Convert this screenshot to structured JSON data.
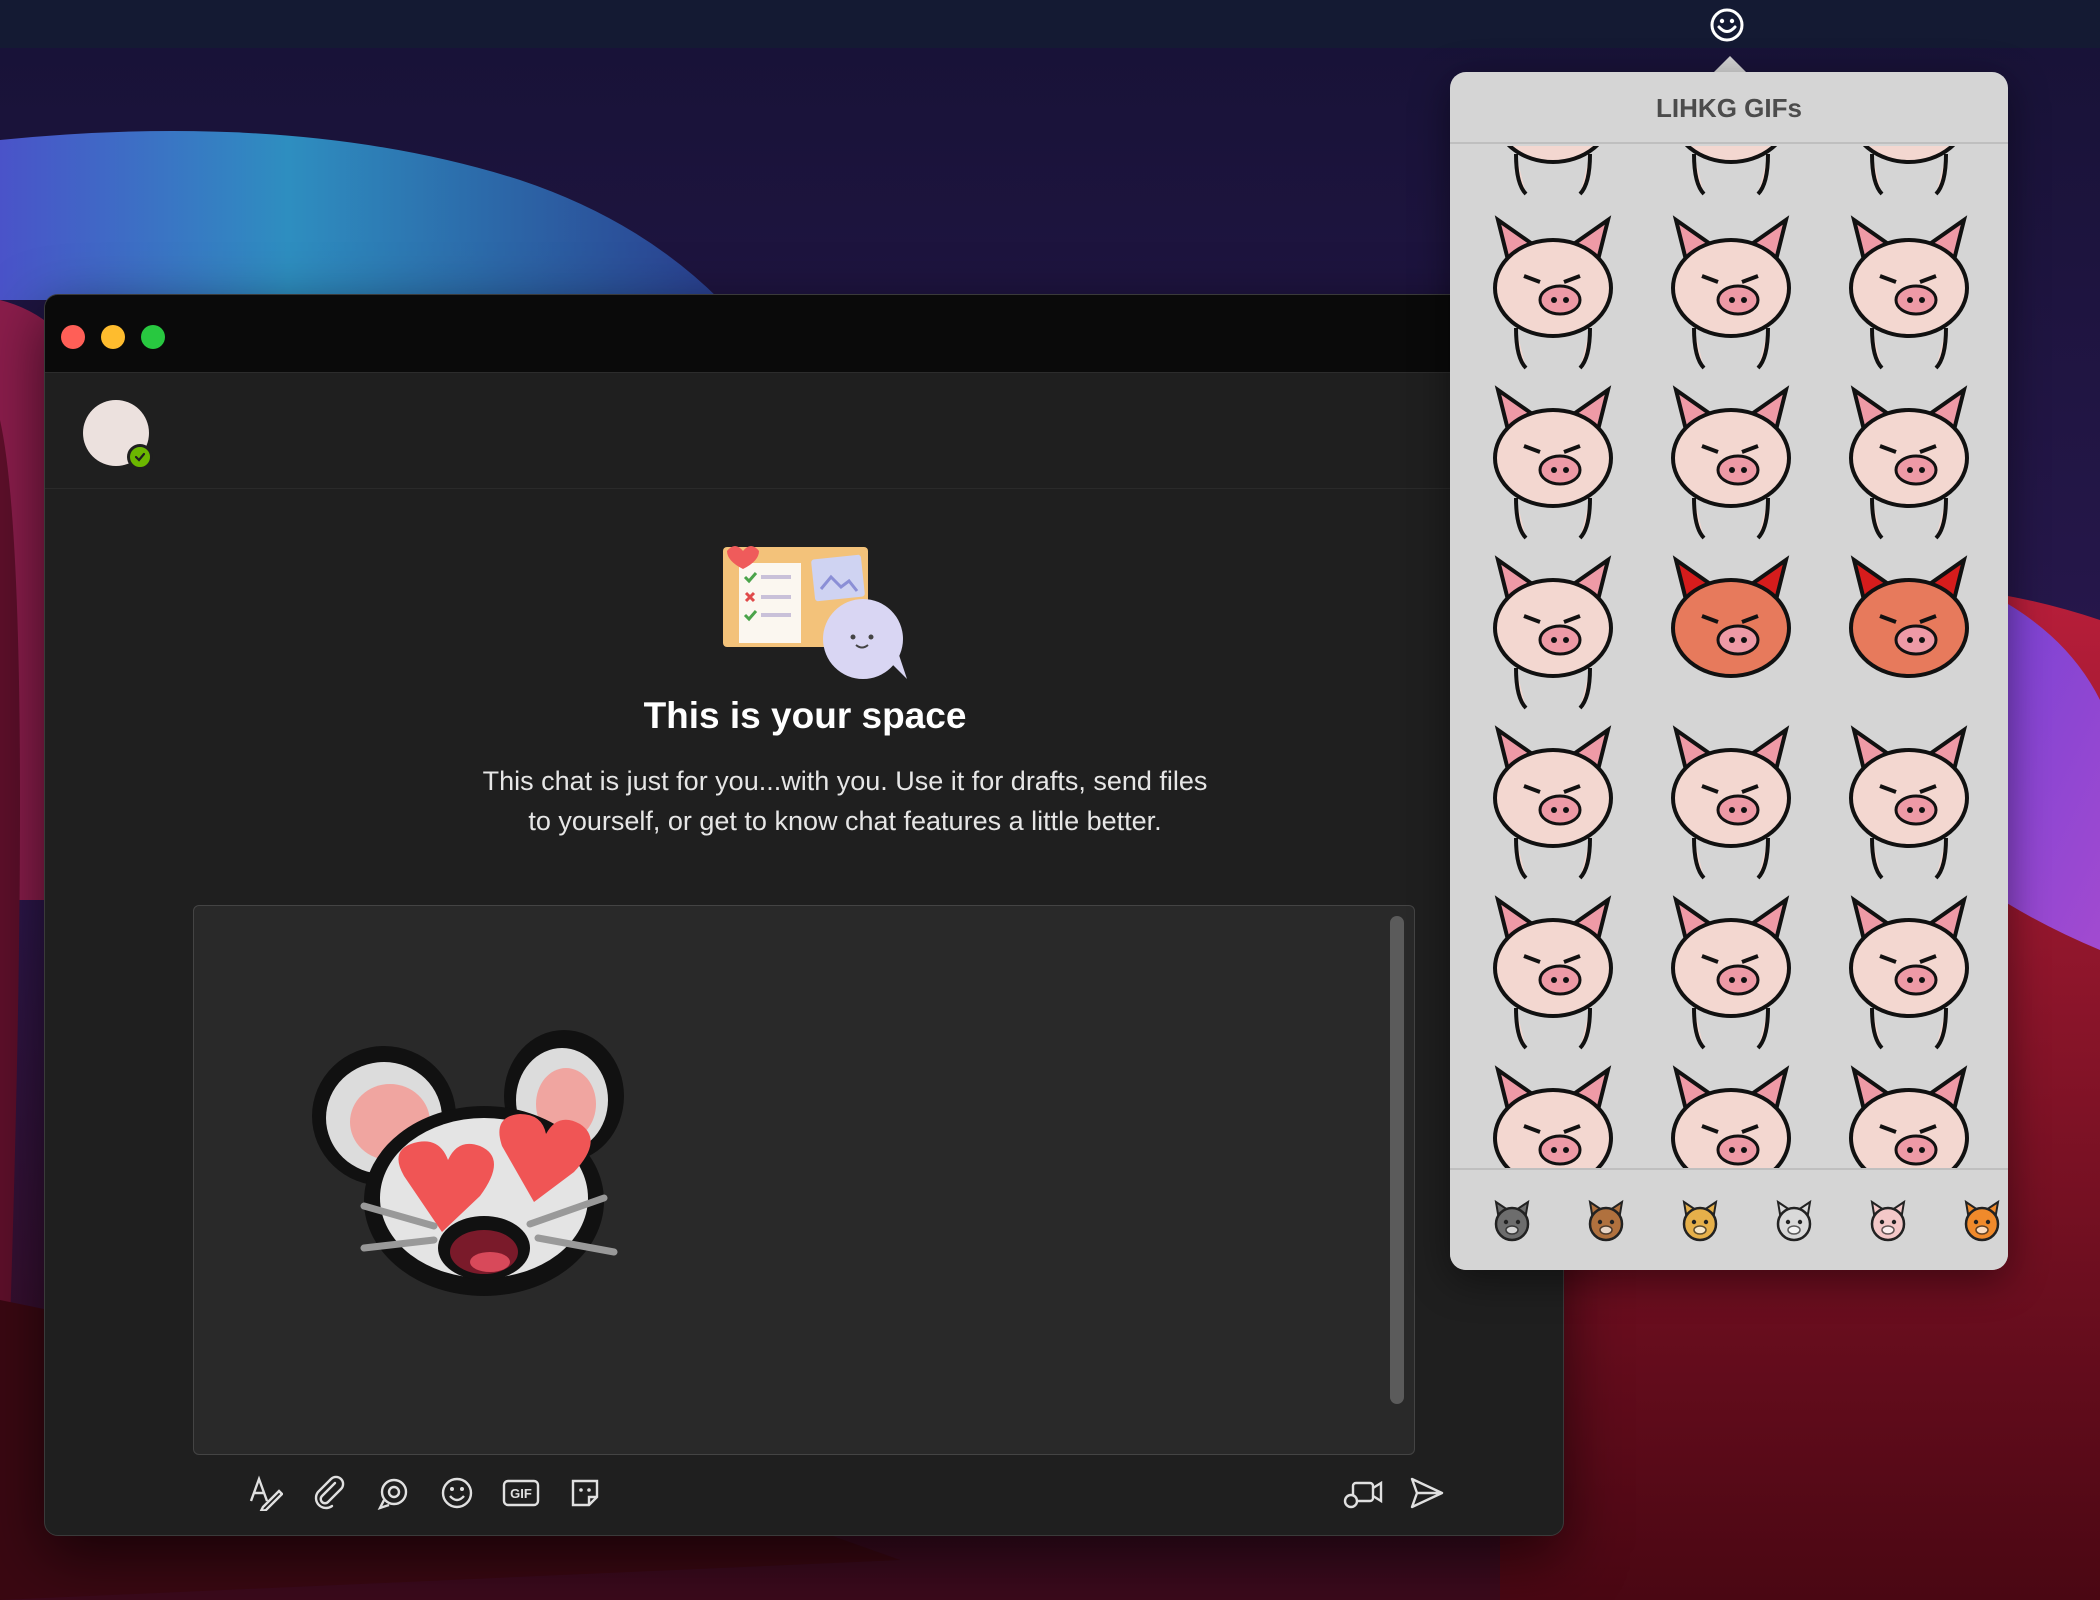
{
  "window": {
    "title_buttons": [
      "close",
      "minimize",
      "maximize"
    ]
  },
  "chat": {
    "title": "This is your space",
    "description_line1": "This chat is just for you...with you. Use it for drafts, send files",
    "description_line2": "to yourself, or get to know chat features a little better."
  },
  "compose": {
    "attachment": "mouse-hearts-sticker"
  },
  "toolbar": {
    "gif_label": "GIF",
    "tools": [
      "format-icon",
      "attach-icon",
      "loop-icon",
      "emoji-icon",
      "gif-icon",
      "sticker-icon",
      "meet-now-icon",
      "send-icon"
    ]
  },
  "picker": {
    "title": "LIHKG GIFs",
    "tabs": [
      "cat",
      "cow",
      "dog",
      "mouse",
      "pig",
      "tiger"
    ],
    "selected_tab": "pig"
  },
  "colors": {
    "accent_green": "#6bb700",
    "pig_pink": "#f3d7d0",
    "angry_red": "#d61c1c"
  }
}
